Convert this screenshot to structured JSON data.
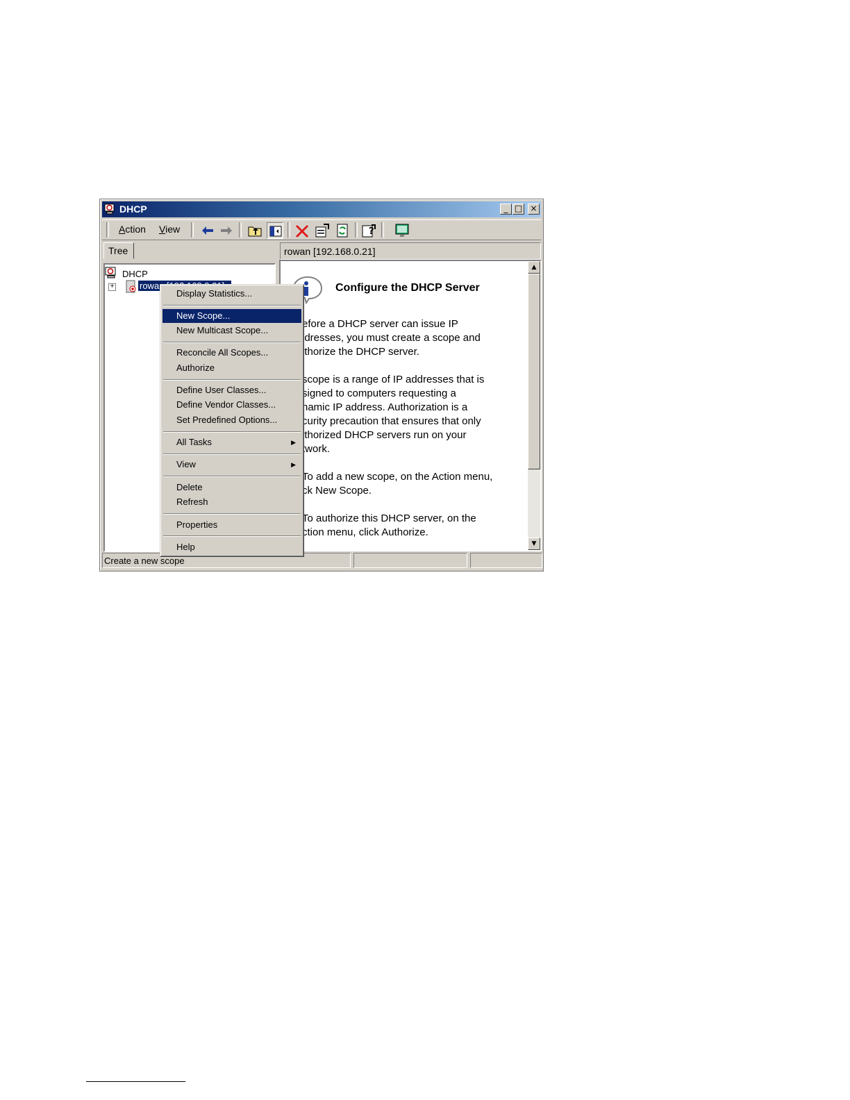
{
  "window": {
    "title": "DHCP",
    "controls": {
      "minimize": "_",
      "maximize": "□",
      "close": "×"
    }
  },
  "menubar": {
    "action": "Action",
    "view": "View"
  },
  "toolbar": {
    "icons": [
      "back-arrow-icon",
      "forward-arrow-icon",
      "up-one-level-icon",
      "show-hide-console-tree-icon",
      "delete-icon",
      "properties-icon",
      "refresh-icon",
      "help-icon",
      "console-icon"
    ]
  },
  "tree": {
    "tab_label": "Tree",
    "root_label": "DHCP",
    "server_label": "rowan [192.168.0.21]"
  },
  "detail": {
    "header": "rowan [192.168.0.21]",
    "heading": "Configure the DHCP Server",
    "paragraphs": [
      "efore a DHCP server can issue IP\nldresses, you must create a scope and\nithorize the DHCP server.",
      "scope is a range of IP addresses that is\nsigned to computers requesting a\nnamic IP address. Authorization is a\ncurity precaution that ensures that only\nithorized DHCP servers run on your\ntwork.",
      "To add a new scope, on the Action menu,\nck New Scope.",
      "To authorize this DHCP server, on the\nction menu, click Authorize."
    ]
  },
  "status": {
    "text": "Create a new scope"
  },
  "context_menu": {
    "items": [
      {
        "label": "Display Statistics..."
      },
      {
        "label": "New Scope...",
        "highlighted": true
      },
      {
        "label": "New Multicast Scope..."
      },
      {
        "label": "Reconcile All Scopes..."
      },
      {
        "label": "Authorize"
      },
      {
        "label": "Define User Classes..."
      },
      {
        "label": "Define Vendor Classes..."
      },
      {
        "label": "Set Predefined Options..."
      },
      {
        "label": "All Tasks",
        "submenu": true
      },
      {
        "label": "View",
        "submenu": true
      },
      {
        "label": "Delete"
      },
      {
        "label": "Refresh"
      },
      {
        "label": "Properties"
      },
      {
        "label": "Help"
      }
    ]
  },
  "colors": {
    "highlight": "#0a246a",
    "face": "#d4d0c8",
    "title_start": "#0a246a",
    "title_end": "#a6caf0"
  }
}
